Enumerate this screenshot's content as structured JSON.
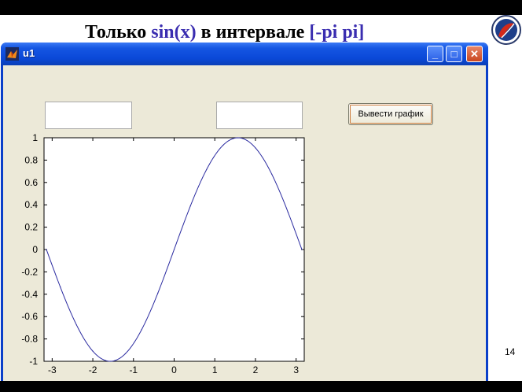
{
  "slide": {
    "title_prefix": "Только ",
    "title_func": "sin(x)",
    "title_middle": " в интервале ",
    "title_range": "[-pi pi]",
    "page_number": "14"
  },
  "window": {
    "title": "u1",
    "minimize_glyph": "_",
    "maximize_glyph": "□",
    "close_glyph": "✕"
  },
  "controls": {
    "edit1_value": "",
    "edit2_value": "",
    "plot_button_label": "Вывести график"
  },
  "colors": {
    "title_accent": "#3a2db0",
    "curve": "#2b2ba0",
    "window_client": "#ece9d8"
  },
  "chart_data": {
    "type": "line",
    "title": "",
    "xlabel": "",
    "ylabel": "",
    "function": "sin(x)",
    "xlim": [
      -3.2,
      3.2
    ],
    "ylim": [
      -1,
      1
    ],
    "xticks": [
      -3,
      -2,
      -1,
      0,
      1,
      2,
      3
    ],
    "yticks": [
      1,
      0.8,
      0.6,
      0.4,
      0.2,
      0,
      -0.2,
      -0.4,
      -0.6,
      -0.8,
      -1
    ],
    "x": [
      -3.1416,
      -2.8,
      -2.4,
      -2.0,
      -1.5708,
      -1.2,
      -0.8,
      -0.4,
      0,
      0.4,
      0.8,
      1.2,
      1.5708,
      2.0,
      2.4,
      2.8,
      3.1416
    ],
    "y": [
      0,
      -0.335,
      -0.675,
      -0.909,
      -1,
      -0.932,
      -0.717,
      -0.389,
      0,
      0.389,
      0.717,
      0.932,
      1,
      0.909,
      0.675,
      0.335,
      0
    ],
    "grid": false
  }
}
